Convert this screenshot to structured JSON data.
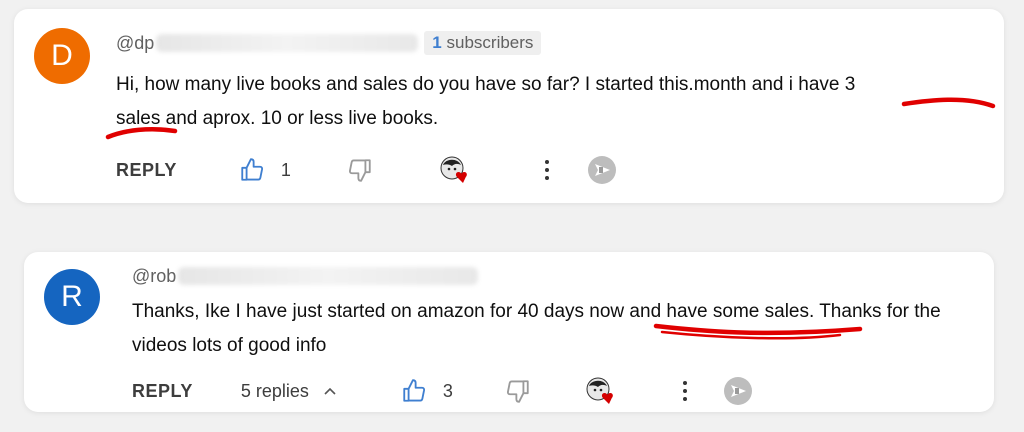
{
  "comments": [
    {
      "avatar_letter": "D",
      "avatar_color": "#ef6c00",
      "handle": "@dp",
      "subscribers_count": "1",
      "subscribers_label": "subscribers",
      "text_line1": "Hi, how many live books and sales do you have so far? I started this.month and i have 3",
      "text_line2": "sales and aprox. 10 or less live books.",
      "reply_label": "REPLY",
      "like_count": "1",
      "icons": [
        "thumbs-up-icon",
        "thumbs-down-icon",
        "creator-heart-icon",
        "more-vert-icon",
        "send-icon"
      ]
    },
    {
      "avatar_letter": "R",
      "avatar_color": "#1565c0",
      "handle": "@rob",
      "text_line1": "Thanks, Ike I have just started on amazon for 40 days now and have some sales. Thanks for the",
      "text_line2": "videos lots of good info",
      "reply_label": "REPLY",
      "replies_label": "5 replies",
      "like_count": "3",
      "icons": [
        "chevron-up-icon",
        "thumbs-up-icon",
        "thumbs-down-icon",
        "creator-heart-icon",
        "more-vert-icon",
        "send-icon"
      ]
    }
  ],
  "colors": {
    "accent_blue": "#3f7fd0",
    "annotation_red": "#e00000",
    "heart_red": "#d40000"
  }
}
